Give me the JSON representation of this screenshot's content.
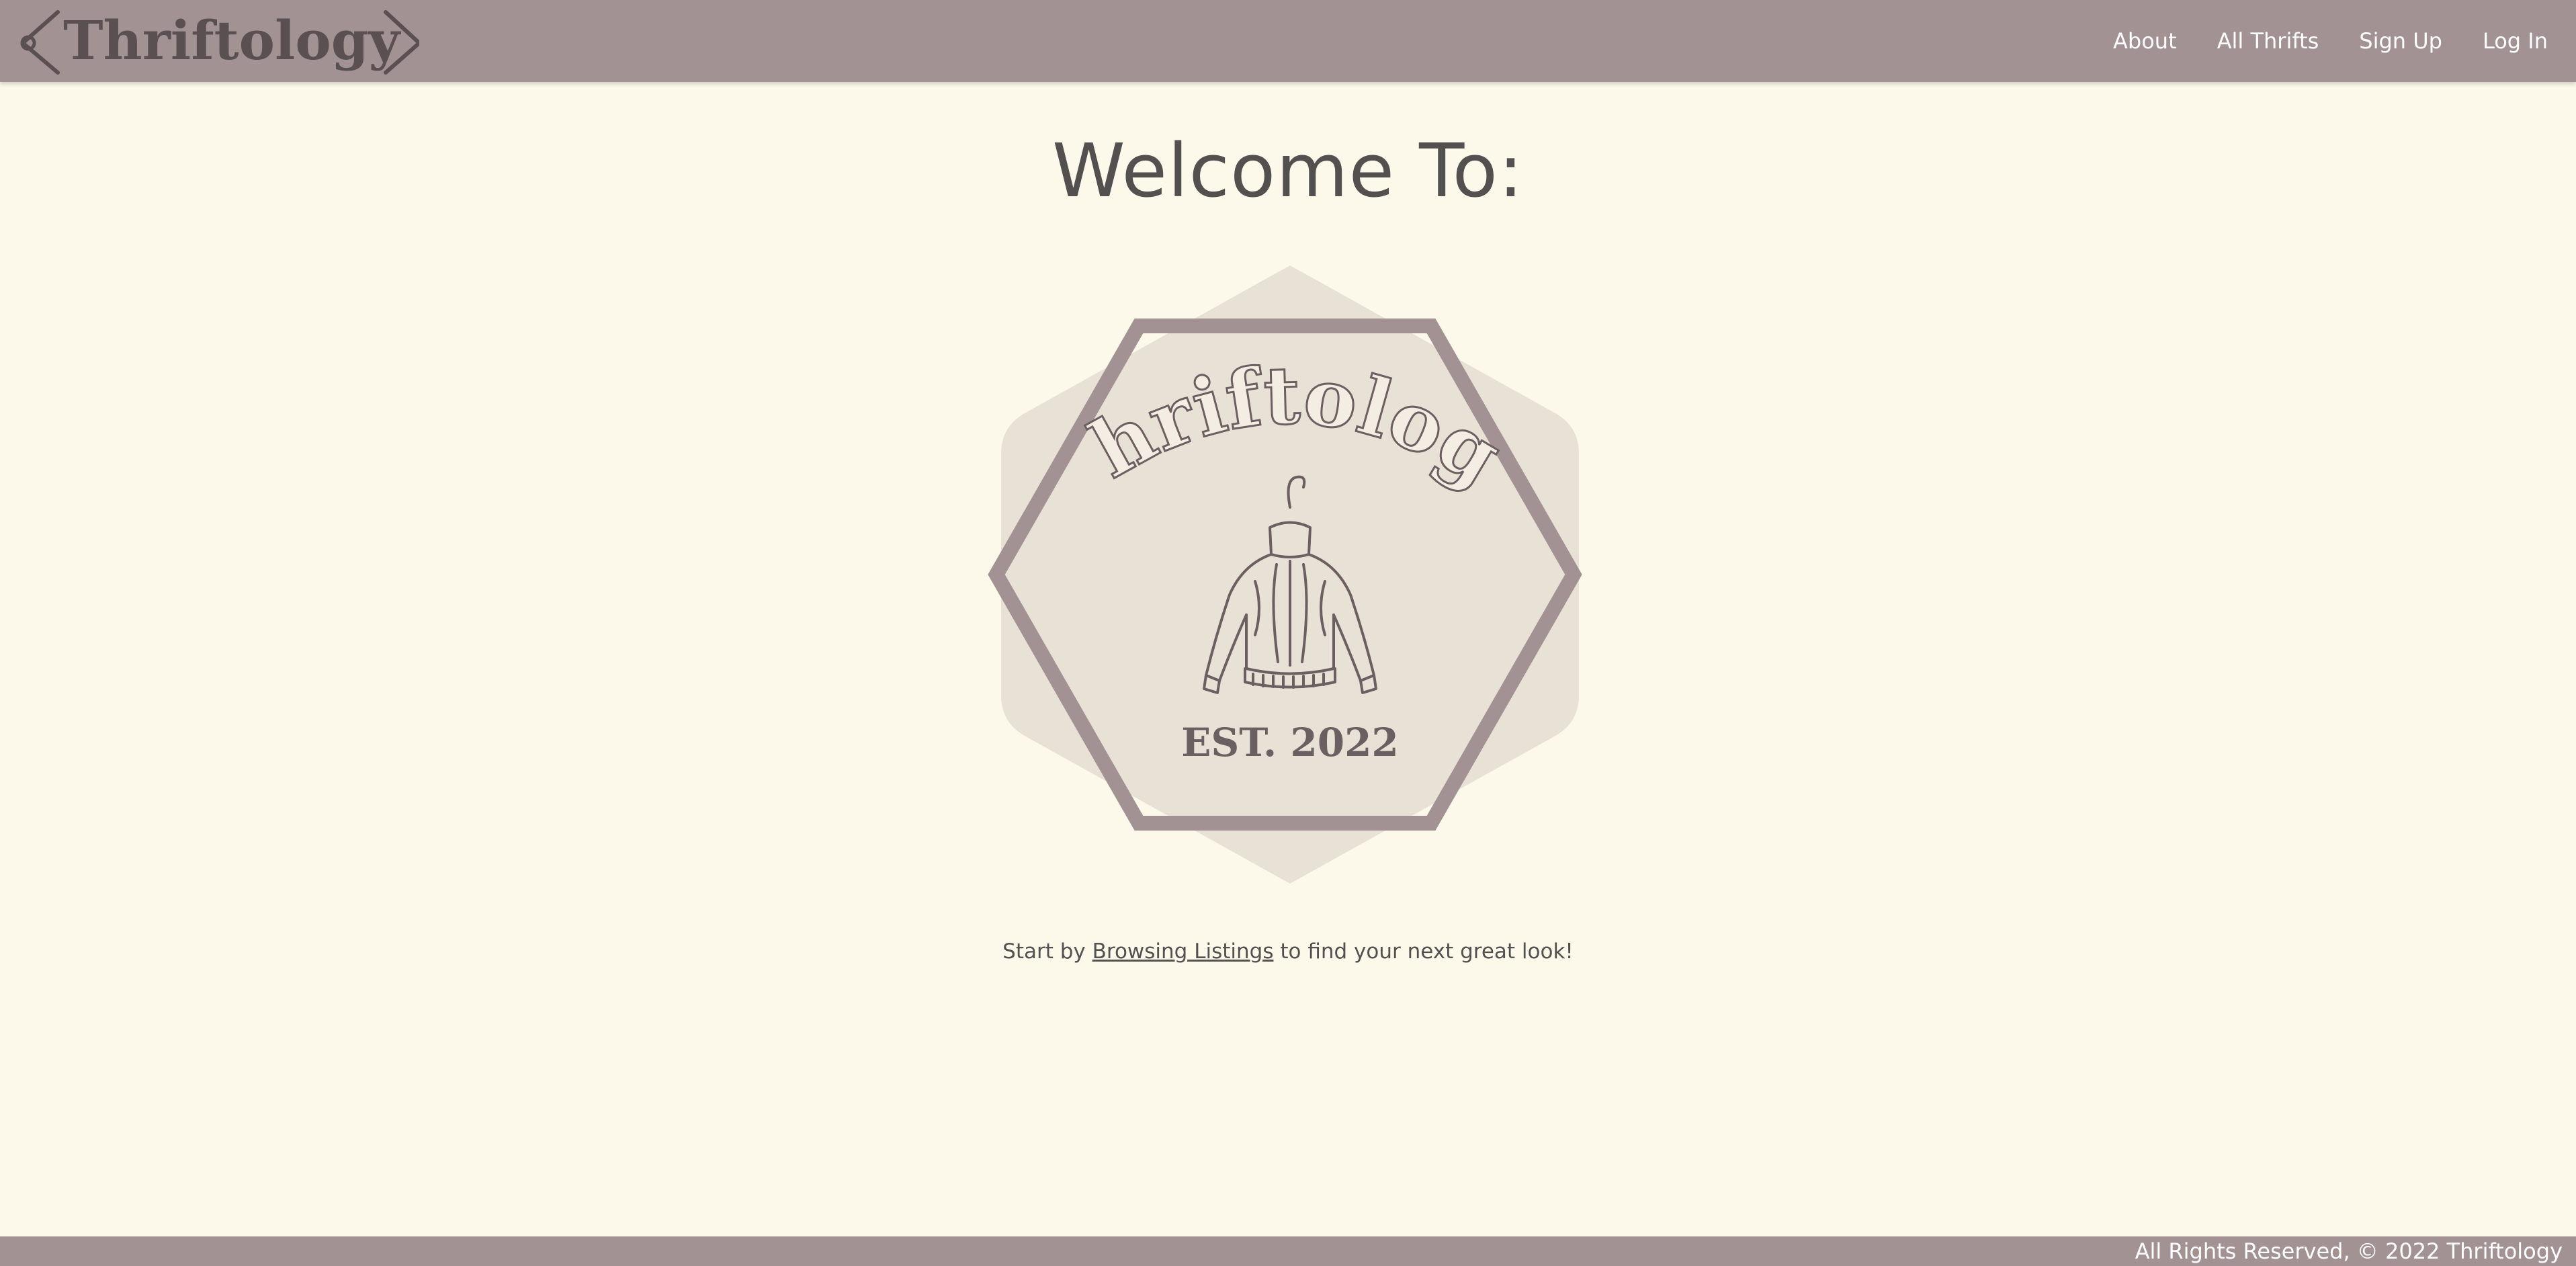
{
  "navbar": {
    "brand_logo": "Thriftology",
    "links": [
      {
        "label": "About"
      },
      {
        "label": "All Thrifts"
      },
      {
        "label": "Sign Up"
      },
      {
        "label": "Log In"
      }
    ]
  },
  "main": {
    "title": "Welcome To:",
    "emblem_logo": {
      "wordmark": "Thriftology",
      "established": "EST. 2022",
      "icon": "sweater-on-hanger-icon"
    },
    "tagline": {
      "before": "Start by ",
      "link": "Browsing Listings",
      "after": " to find your next great look!"
    }
  },
  "footer": {
    "copyright": "All Rights Reserved, © 2022 Thriftology"
  },
  "colors": {
    "background": "#fcf9ea",
    "nav_bar": "#a39293",
    "emblem_fill": "#e8e1d6",
    "text": "#555050"
  }
}
